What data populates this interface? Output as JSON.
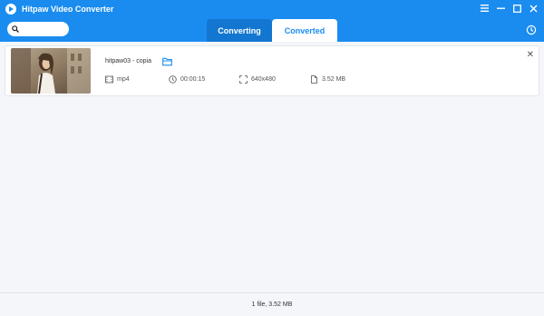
{
  "window": {
    "title": "Hitpaw Video Converter",
    "controls": [
      "menu-icon",
      "minimize-icon",
      "maximize-icon",
      "close-icon"
    ]
  },
  "search": {
    "value": "",
    "placeholder": ""
  },
  "tabs": [
    {
      "label": "Converting",
      "active": false
    },
    {
      "label": "Converted",
      "active": true
    }
  ],
  "file": {
    "name": "hitpaw03 - copia",
    "format": "mp4",
    "duration": "00:00:15",
    "resolution": "640x480",
    "size": "3.52 MB"
  },
  "footer": {
    "summary": "1 file, 3.52 MB"
  },
  "colors": {
    "accent": "#1a8cf0",
    "tab_inactive": "#1376d1",
    "background": "#f4f6fa"
  }
}
